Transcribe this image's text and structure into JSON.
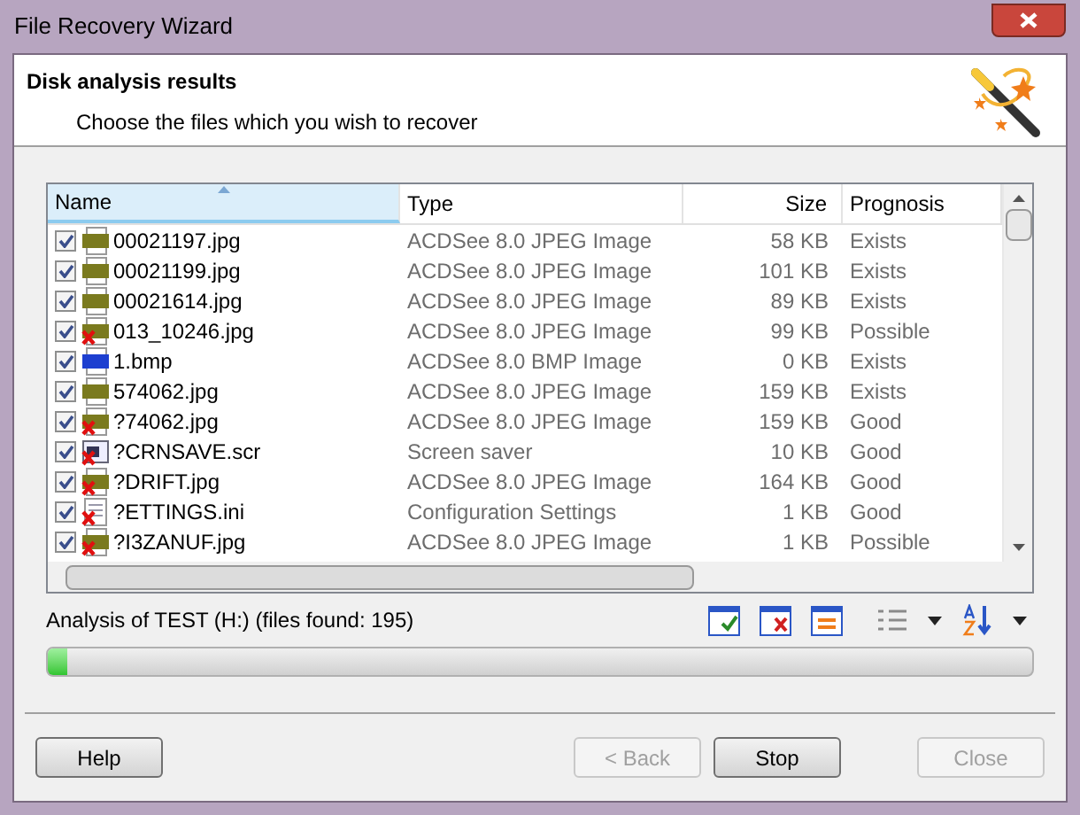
{
  "window": {
    "title": "File Recovery Wizard"
  },
  "header": {
    "title": "Disk analysis results",
    "subtitle": "Choose the files which you wish to recover"
  },
  "table": {
    "columns": [
      "Name",
      "Type",
      "Size",
      "Prognosis"
    ],
    "rows": [
      {
        "checked": true,
        "kind": "jpg",
        "deleted": false,
        "name": "00021197.jpg",
        "type": "ACDSee 8.0 JPEG Image",
        "size": "58 KB",
        "prognosis": "Exists"
      },
      {
        "checked": true,
        "kind": "jpg",
        "deleted": false,
        "name": "00021199.jpg",
        "type": "ACDSee 8.0 JPEG Image",
        "size": "101 KB",
        "prognosis": "Exists"
      },
      {
        "checked": true,
        "kind": "jpg",
        "deleted": false,
        "name": "00021614.jpg",
        "type": "ACDSee 8.0 JPEG Image",
        "size": "89 KB",
        "prognosis": "Exists"
      },
      {
        "checked": true,
        "kind": "jpg",
        "deleted": true,
        "name": "013_10246.jpg",
        "type": "ACDSee 8.0 JPEG Image",
        "size": "99 KB",
        "prognosis": "Possible"
      },
      {
        "checked": true,
        "kind": "bmp",
        "deleted": false,
        "name": "1.bmp",
        "type": "ACDSee 8.0 BMP Image",
        "size": "0 KB",
        "prognosis": "Exists"
      },
      {
        "checked": true,
        "kind": "jpg",
        "deleted": false,
        "name": "574062.jpg",
        "type": "ACDSee 8.0 JPEG Image",
        "size": "159 KB",
        "prognosis": "Exists"
      },
      {
        "checked": true,
        "kind": "jpg",
        "deleted": true,
        "name": "?74062.jpg",
        "type": "ACDSee 8.0 JPEG Image",
        "size": "159 KB",
        "prognosis": "Good"
      },
      {
        "checked": true,
        "kind": "scr",
        "deleted": true,
        "name": "?CRNSAVE.scr",
        "type": "Screen saver",
        "size": "10 KB",
        "prognosis": "Good"
      },
      {
        "checked": true,
        "kind": "jpg",
        "deleted": true,
        "name": "?DRIFT.jpg",
        "type": "ACDSee 8.0 JPEG Image",
        "size": "164 KB",
        "prognosis": "Good"
      },
      {
        "checked": true,
        "kind": "ini",
        "deleted": true,
        "name": "?ETTINGS.ini",
        "type": "Configuration Settings",
        "size": "1 KB",
        "prognosis": "Good"
      },
      {
        "checked": true,
        "kind": "jpg",
        "deleted": true,
        "name": "?I3ZANUF.jpg",
        "type": "ACDSee 8.0 JPEG Image",
        "size": "1 KB",
        "prognosis": "Possible"
      }
    ]
  },
  "status": {
    "text": "Analysis of TEST (H:) (files found: 195)",
    "progress": {
      "level": 0.02
    }
  },
  "buttons": [
    {
      "label": "Help",
      "disabled": false
    },
    {
      "label": "< Back",
      "disabled": true
    },
    {
      "label": "Stop",
      "disabled": false
    },
    {
      "label": "Close",
      "disabled": true
    }
  ]
}
